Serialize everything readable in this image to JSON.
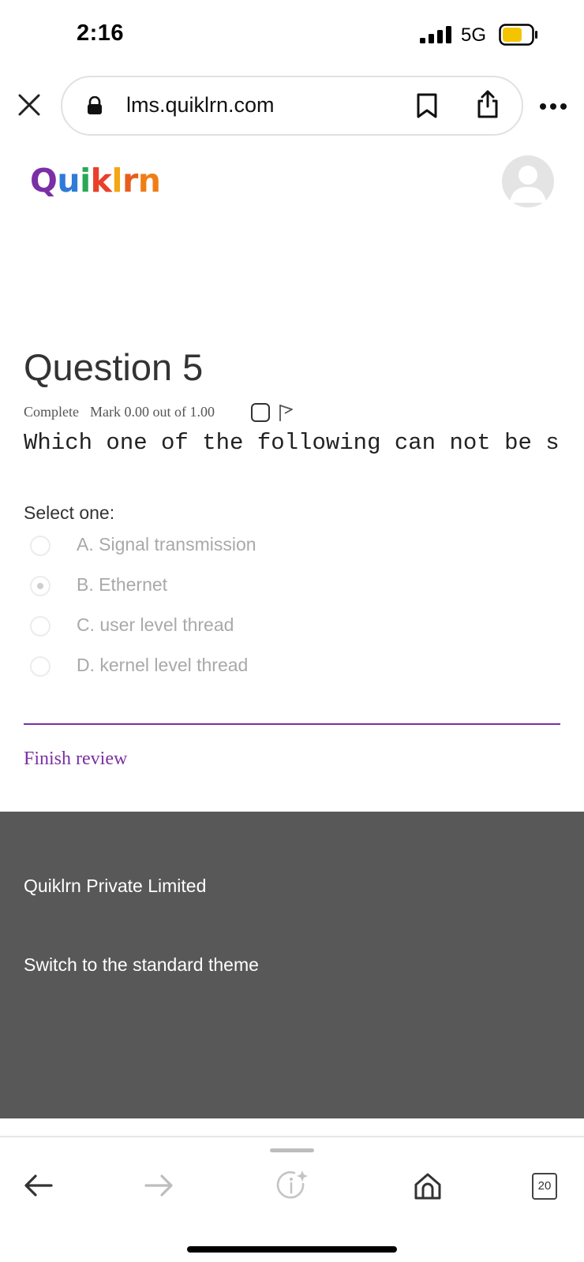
{
  "status_bar": {
    "time": "2:16",
    "network": "5G",
    "battery_color": "#f5c400"
  },
  "browser": {
    "url": "lms.quiklrn.com",
    "icons": [
      "close-icon",
      "lock-icon",
      "bookmark-icon",
      "share-icon",
      "more-icon"
    ]
  },
  "header": {
    "logo": [
      "Q",
      "u",
      "i",
      "k",
      "l",
      "r",
      "n"
    ]
  },
  "question": {
    "title": "Question 5",
    "state": "Complete",
    "mark": "Mark 0.00 out of 1.00",
    "text": "Which one of the following can not be s",
    "select_label": "Select one:",
    "options": [
      {
        "label": "A. Signal transmission",
        "selected": false
      },
      {
        "label": "B. Ethernet",
        "selected": true
      },
      {
        "label": "C. user level thread",
        "selected": false
      },
      {
        "label": "D. kernel level thread",
        "selected": false
      }
    ]
  },
  "finish_link": "Finish review",
  "footer": {
    "company": "Quiklrn Private Limited",
    "theme_link": "Switch to the standard theme"
  },
  "bottom_bar": {
    "tabs_count": "20"
  },
  "colors": {
    "accent": "#7b2fa5",
    "footer_bg": "#585858"
  }
}
